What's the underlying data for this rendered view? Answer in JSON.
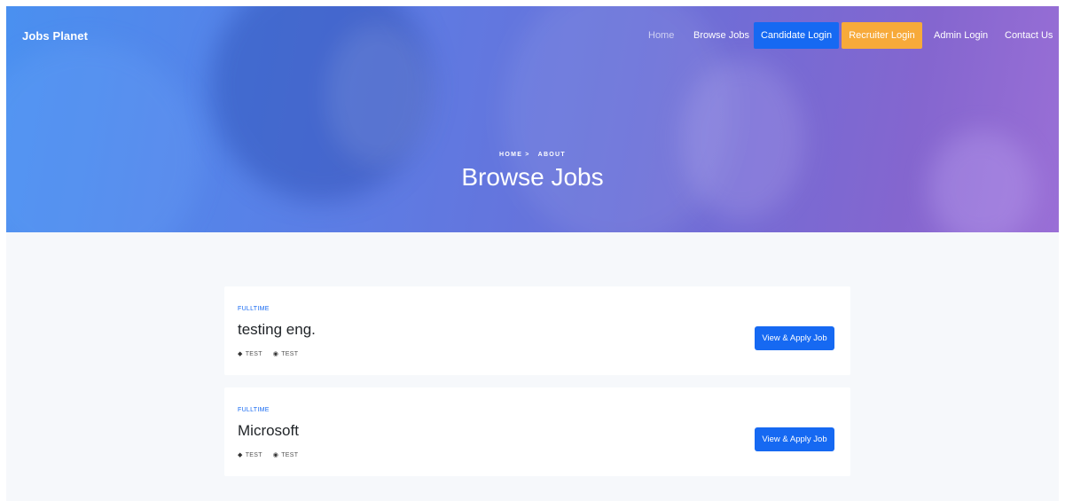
{
  "header": {
    "brand": "Jobs Planet",
    "nav": {
      "home": "Home",
      "browse_jobs": "Browse Jobs",
      "candidate_login": "Candidate Login",
      "recruiter_login": "Recruiter Login",
      "admin_login": "Admin Login",
      "contact_us": "Contact Us"
    },
    "breadcrumb": [
      "HOME",
      ">",
      "ABOUT"
    ],
    "title": "Browse Jobs"
  },
  "jobs": [
    {
      "type": "FULLTIME",
      "title": "testing eng.",
      "meta1": "TEST",
      "meta2": "TEST",
      "button": "View & Apply Job"
    },
    {
      "type": "FULLTIME",
      "title": "Microsoft",
      "meta1": "TEST",
      "meta2": "TEST",
      "button": "View & Apply Job"
    }
  ],
  "colors": {
    "primary": "#1669f2",
    "recruiter": "#f7aa3a",
    "hero_from": "#4a90f0",
    "hero_to": "#9a6fd6"
  },
  "icons": {
    "meta1": "layers-icon",
    "meta2": "location-icon"
  }
}
